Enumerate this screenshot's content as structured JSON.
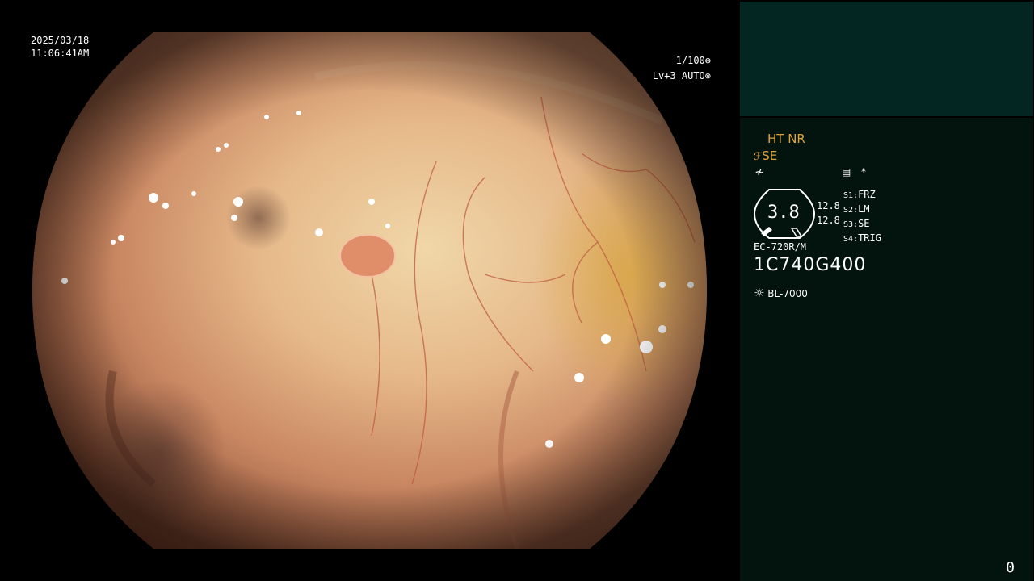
{
  "overlay": {
    "date": "2025/03/18",
    "time": "11:06:41AM",
    "shutter": "1/100",
    "shutter_icon": "aperture-icon",
    "level": "Lv+3 AUTO",
    "auto_icon": "auto-mode-icon"
  },
  "panel": {
    "ht_nr": "HT NR",
    "se_label": "SE",
    "se_icon": "enhance-icon",
    "not_equal_icon": "not-equal-icon",
    "memo_icon": "memo-icon",
    "asterisk": "*",
    "gauge_value": "3.8",
    "gauge_left_1": "12.8",
    "gauge_left_2": "12.8",
    "switches": [
      {
        "key": "S1:",
        "value": "FRZ"
      },
      {
        "key": "S2:",
        "value": "LM"
      },
      {
        "key": "S3:",
        "value": "SE"
      },
      {
        "key": "S4:",
        "value": "TRIG"
      }
    ],
    "scope_model": "EC-720R/M",
    "serial": "1C740G400",
    "light_source": "BL-7000",
    "light_icon": "sun-icon"
  },
  "counter": "0",
  "colors": {
    "panel_top": "#032622",
    "panel_bottom": "#03140F",
    "accent_orange": "#E0A23A"
  }
}
